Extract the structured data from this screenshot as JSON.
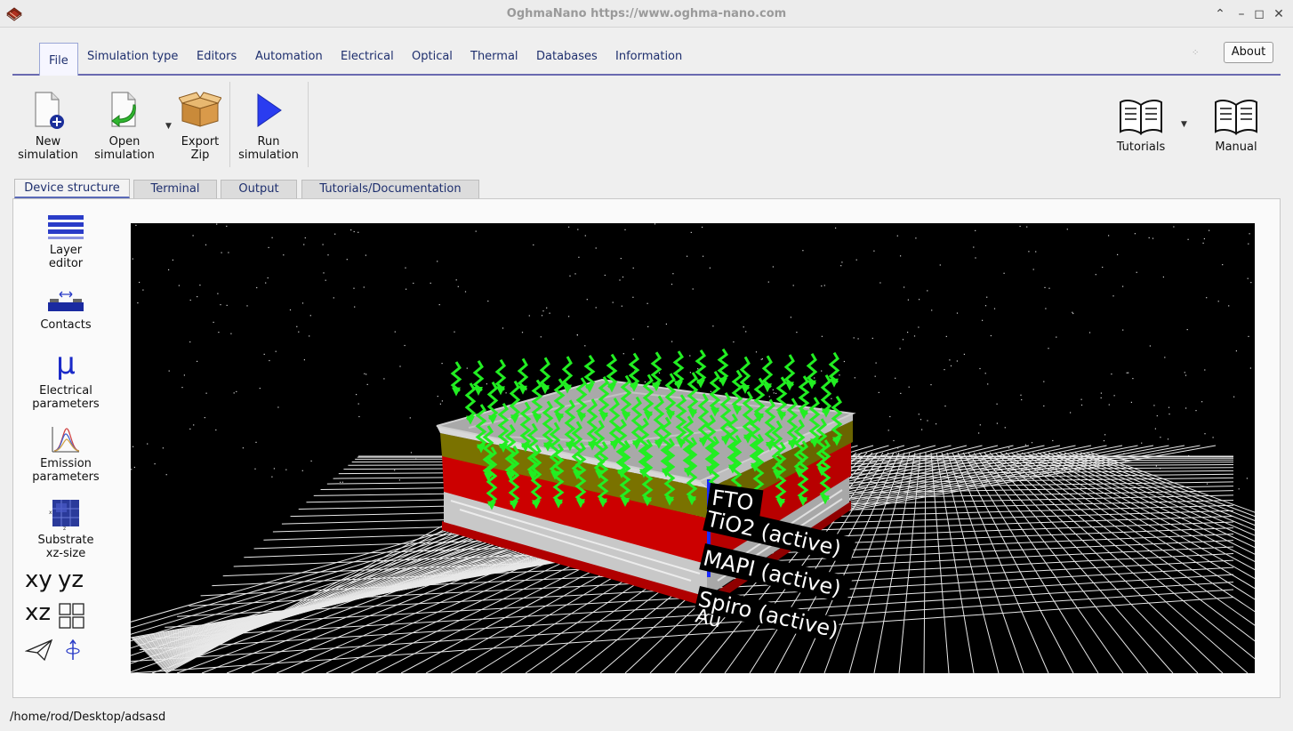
{
  "window": {
    "title": "OghmaNano https://www.oghma-nano.com",
    "controls": [
      "chevron-up-icon",
      "minimize-icon",
      "maximize-icon",
      "close-icon"
    ]
  },
  "menu": {
    "tabs": [
      "File",
      "Simulation type",
      "Editors",
      "Automation",
      "Electrical",
      "Optical",
      "Thermal",
      "Databases",
      "Information"
    ],
    "active": "File",
    "about_label": "About"
  },
  "ribbon": {
    "new_simulation": "New\nsimulation",
    "open_simulation": "Open\nsimulation",
    "export_zip": "Export\nZip",
    "run_simulation": "Run\nsimulation",
    "tutorials": "Tutorials",
    "manual": "Manual"
  },
  "subtabs": {
    "items": [
      "Device structure",
      "Terminal",
      "Output",
      "Tutorials/Documentation"
    ],
    "active": "Device structure"
  },
  "sidebar": {
    "layer_editor": "Layer\neditor",
    "contacts": "Contacts",
    "electrical_parameters": "Electrical\nparameters",
    "mu_symbol": "μ",
    "emission_parameters": "Emission\nparameters",
    "substrate_size": "Substrate\nxz-size",
    "view_xy": "xy",
    "view_yz": "yz",
    "view_xz": "xz"
  },
  "device": {
    "layers": [
      {
        "label": "FTO",
        "color": "#c8c8c8"
      },
      {
        "label": "TiO2 (active)",
        "color": "#7a7200"
      },
      {
        "label": "MAPI (active)",
        "color": "#cc0000"
      },
      {
        "label": "Spiro (active)",
        "color": "#d0d0d0"
      },
      {
        "label": "Au",
        "color": "#cc0000"
      }
    ],
    "photon_color": "#22ee22"
  },
  "status": {
    "path": "/home/rod/Desktop/adsasd"
  },
  "colors": {
    "accent": "#1e2f6e",
    "tab_border": "#6a6ab0"
  }
}
